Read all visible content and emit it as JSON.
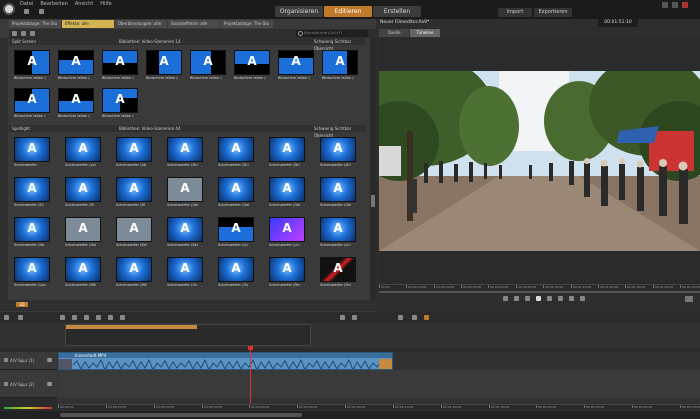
{
  "app": {
    "menu": [
      "Datei",
      "Bearbeiten",
      "Ansicht",
      "Hilfe"
    ],
    "main_tabs": [
      {
        "label": "Organisieren",
        "active": false
      },
      {
        "label": "Editieren",
        "active": true
      },
      {
        "label": "Erstellen",
        "active": false
      }
    ],
    "import_label": "Import",
    "export_label": "Exportieren"
  },
  "library": {
    "tabs": [
      {
        "label": "Projektablage: The Stu",
        "active": false
      },
      {
        "label": "Effekte: alle",
        "active": true
      },
      {
        "label": "Überblendungen: alle",
        "active": false
      },
      {
        "label": "Soundeffekte: alle",
        "active": false
      },
      {
        "label": "Projektablage: The Stu",
        "active": false
      }
    ],
    "search_placeholder": "Schnellsuche (Ctrl+F)",
    "sections": [
      {
        "title": "Split Screen",
        "info": "Bibliothek: Video-Szenerien 14",
        "sort": "Schwierig Sichtbar Übersicht",
        "items": [
          {
            "label": "Bildschirm teilen (",
            "kind": "split1"
          },
          {
            "label": "Bildschirm teilen (",
            "kind": "split2"
          },
          {
            "label": "Bildschirm teilen (",
            "kind": "split3"
          },
          {
            "label": "Bildschirm teilen (",
            "kind": "split4"
          },
          {
            "label": "Bildschirm teilen (",
            "kind": "split5"
          },
          {
            "label": "Bildschirm teilen (",
            "kind": "split6"
          },
          {
            "label": "Bildschirm teilen (",
            "kind": "split7"
          },
          {
            "label": "Bildschirm teilen (",
            "kind": "split8"
          },
          {
            "label": "Bildschirm teilen (",
            "kind": "split9"
          },
          {
            "label": "Bildschirm teilen (",
            "kind": "split10"
          },
          {
            "label": "Bildschirm teilen (",
            "kind": "split11"
          }
        ]
      },
      {
        "title": "Spotlight",
        "info": "Bibliothek: Video-Szenerien 44",
        "sort": "Schwierig Sichtbar Übersicht",
        "items": [
          {
            "label": "Scheinwerfer",
            "kind": "spot"
          },
          {
            "label": "Scheinwerfer (vol",
            "kind": "spot"
          },
          {
            "label": "Scheinwerfer (Ab",
            "kind": "spot"
          },
          {
            "label": "Scheinwerfer (Dri",
            "kind": "spot"
          },
          {
            "label": "Scheinwerfer (Dri",
            "kind": "spot"
          },
          {
            "label": "Scheinwerfer (Dri",
            "kind": "spot"
          },
          {
            "label": "Scheinwerfer (Dri",
            "kind": "spot"
          },
          {
            "label": "Scheinwerfer (Eli",
            "kind": "spot"
          },
          {
            "label": "Scheinwerfer (Fil",
            "kind": "spot"
          },
          {
            "label": "Scheinwerfer (Fil",
            "kind": "spot"
          },
          {
            "label": "Scheinwerfer (Gel",
            "kind": "grey"
          },
          {
            "label": "Scheinwerfer (Gel",
            "kind": "spot"
          },
          {
            "label": "Scheinwerfer (Gel",
            "kind": "spot"
          },
          {
            "label": "Scheinwerfer (Gel",
            "kind": "spot"
          },
          {
            "label": "Scheinwerfer (Ho",
            "kind": "spot"
          },
          {
            "label": "Scheinwerfer (Hol",
            "kind": "grey"
          },
          {
            "label": "Scheinwerfer (Kei",
            "kind": "grey"
          },
          {
            "label": "Scheinwerfer (Kei",
            "kind": "spot"
          },
          {
            "label": "Scheinwerfer (Lic",
            "kind": "split2"
          },
          {
            "label": "Scheinwerfer (Lin",
            "kind": "purple"
          },
          {
            "label": "Scheinwerfer (Lin",
            "kind": "spot"
          },
          {
            "label": "Scheinwerfer (Lon",
            "kind": "spot"
          },
          {
            "label": "Scheinwerfer (Mit",
            "kind": "spot"
          },
          {
            "label": "Scheinwerfer (Mit",
            "kind": "spot"
          },
          {
            "label": "Scheinwerfer (Ov",
            "kind": "spot"
          },
          {
            "label": "Scheinwerfer (Ov",
            "kind": "spot"
          },
          {
            "label": "Scheinwerfer (Par",
            "kind": "spot"
          },
          {
            "label": "Scheinwerfer (Pol",
            "kind": "red"
          }
        ]
      }
    ],
    "status_value": "3D"
  },
  "preview": {
    "title": "Neuer Filmeditor.Ax9*",
    "tabs": [
      {
        "label": "Quelle",
        "active": false
      },
      {
        "label": "Timeline",
        "active": true
      }
    ],
    "timecode": "00:01:51:10",
    "ruler_labels": [
      "00:00",
      "00:00:10:00",
      "00:00:20:00",
      "00:00:30:00",
      "00:00:40:00",
      "00:00:50:00",
      "00:01:00:00",
      "00:01:10:00",
      "00:01:20:00",
      "00:01:30:00",
      "00:01:40:00",
      "00:01:50:00"
    ]
  },
  "timeline": {
    "tracks": [
      {
        "name": "A/V Spur (1)"
      },
      {
        "name": "A/V Spur (2)"
      }
    ],
    "clip_label": "Innenstadt.MP4",
    "ruler_labels": [
      "00:00:00",
      "00:00:10:00",
      "00:00:20:00",
      "00:00:30:00",
      "00:00:40:00",
      "00:00:50:00",
      "00:01:00:00",
      "00:01:10:00",
      "00:01:20:00",
      "00:01:30:00",
      "00:01:40:00",
      "00:01:50:00",
      "00:02:00:00",
      "00:02:10:00"
    ]
  }
}
